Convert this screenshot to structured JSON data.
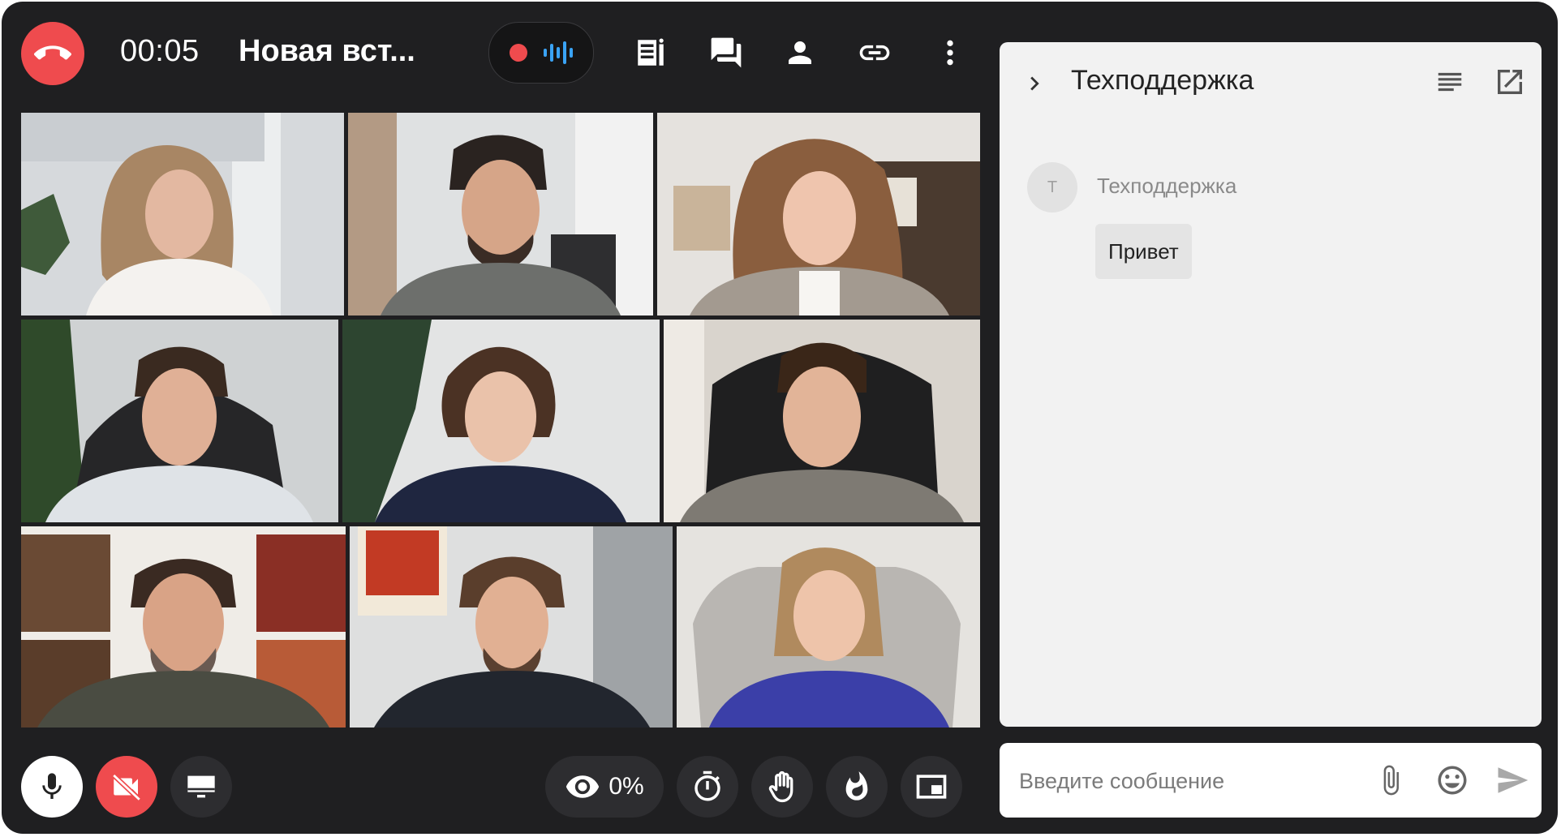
{
  "call": {
    "timer": "00:05",
    "title": "Новая вст...",
    "hangup_icon": "phone-hangup-icon",
    "recording_indicator": "record-dot",
    "audio_indicator": "audio-wave-icon",
    "colors": {
      "hangup": "#ef4b4e",
      "audio": "#3aa3f5",
      "background": "#1f1f21"
    }
  },
  "toolbar": {
    "icons": [
      "notes-icon",
      "chat-icon",
      "participants-icon",
      "link-icon",
      "more-vertical-icon"
    ]
  },
  "participants_count": 9,
  "bottom_bar": {
    "views_percent": "0%",
    "icons": [
      "microphone-icon",
      "camera-off-icon",
      "screen-share-icon",
      "eye-icon",
      "timer-icon",
      "raise-hand-icon",
      "fire-reaction-icon",
      "picture-in-picture-icon"
    ]
  },
  "chat": {
    "title": "Техподдержка",
    "messages": [
      {
        "avatar_letter": "Т",
        "author": "Техподдержка",
        "text": "Привет"
      }
    ],
    "input_placeholder": "Введите сообщение",
    "icons": [
      "chevron-right-icon",
      "list-icon",
      "open-external-icon",
      "attach-icon",
      "emoji-icon",
      "send-icon"
    ]
  }
}
